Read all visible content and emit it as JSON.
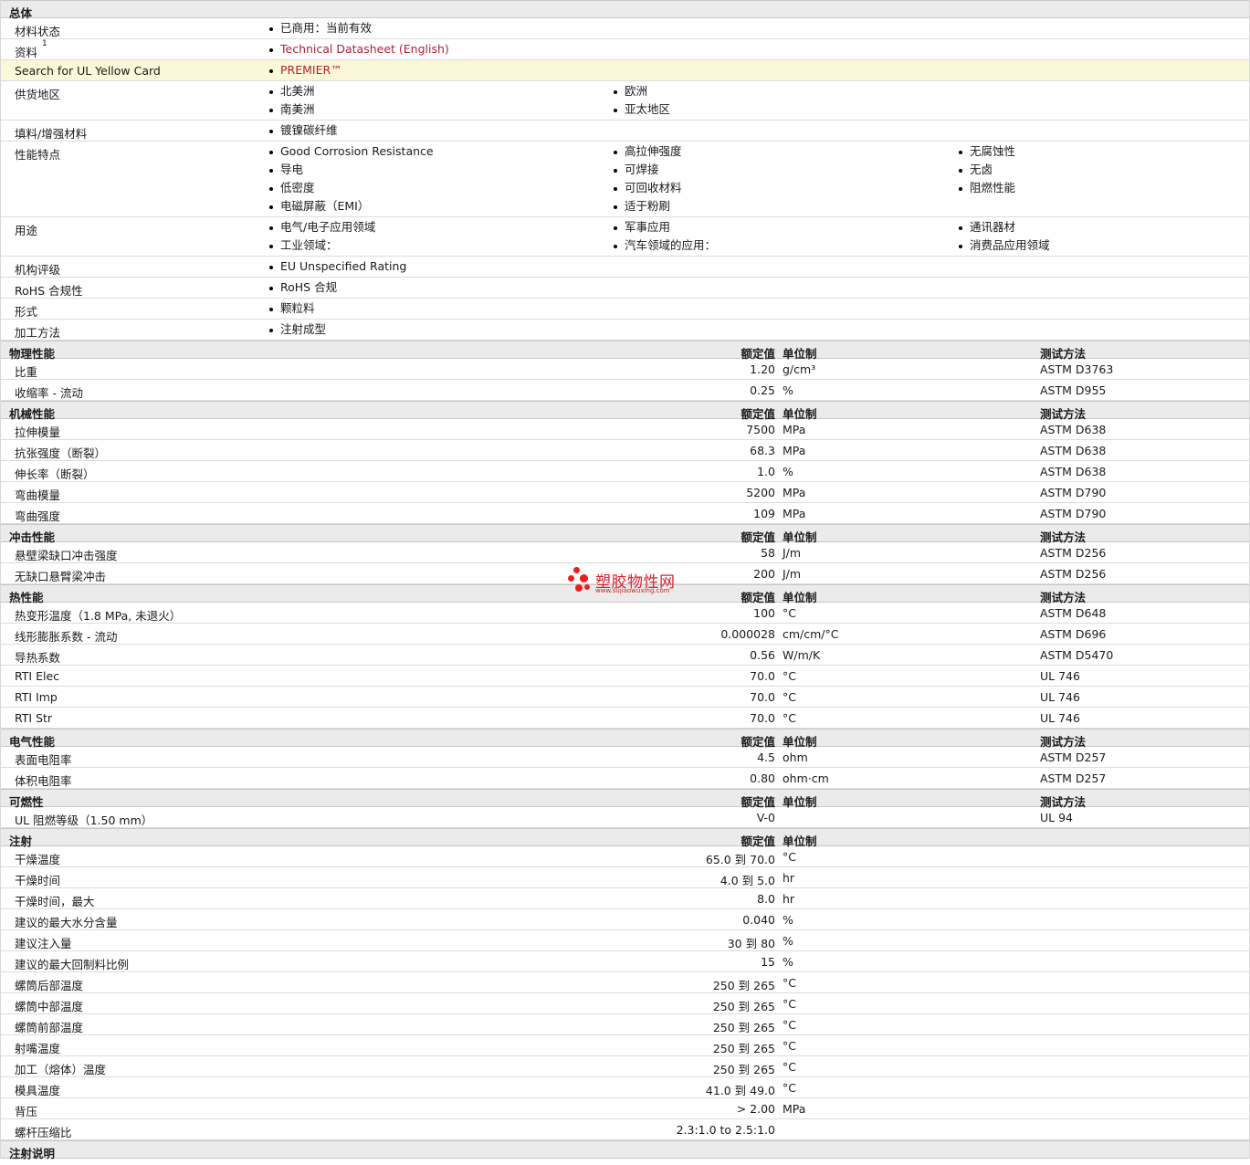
{
  "general": {
    "title": "总体",
    "rows": [
      {
        "label": "材料状态",
        "items": [
          [
            "已商用：当前有效"
          ]
        ]
      },
      {
        "label": "资料",
        "sup": "1",
        "link": true,
        "items": [
          [
            "Technical Datasheet (English)"
          ]
        ]
      },
      {
        "label": "Search for UL Yellow Card",
        "highlight": true,
        "link": true,
        "items": [
          [
            "PREMIER™"
          ]
        ]
      },
      {
        "label": "供货地区",
        "items": [
          [
            "北美洲",
            "南美洲"
          ],
          [
            "欧洲",
            "亚太地区"
          ]
        ]
      },
      {
        "label": "填料/增强材料",
        "items": [
          [
            "镀镍碳纤维"
          ]
        ]
      },
      {
        "label": "性能特点",
        "items": [
          [
            "Good Corrosion Resistance",
            "导电",
            "低密度",
            "电磁屏蔽（EMI）"
          ],
          [
            "高拉伸强度",
            "可焊接",
            "可回收材料",
            "适于粉刷"
          ],
          [
            "无腐蚀性",
            "无卤",
            "阻燃性能"
          ]
        ]
      },
      {
        "label": "用途",
        "items": [
          [
            "电气/电子应用领域",
            "工业领域："
          ],
          [
            "军事应用",
            "汽车领域的应用："
          ],
          [
            "通讯器材",
            "消费品应用领域"
          ]
        ]
      },
      {
        "label": "机构评级",
        "items": [
          [
            "EU Unspecified Rating"
          ]
        ]
      },
      {
        "label": "RoHS 合规性",
        "items": [
          [
            "RoHS 合规"
          ]
        ]
      },
      {
        "label": "形式",
        "items": [
          [
            "颗粒料"
          ]
        ]
      },
      {
        "label": "加工方法",
        "items": [
          [
            "注射成型"
          ]
        ]
      }
    ]
  },
  "col_headers": {
    "nominal": "额定值",
    "unit": "单位制",
    "test": "测试方法"
  },
  "sections": [
    {
      "title": "物理性能",
      "show_test": true,
      "rows": [
        {
          "label": "比重",
          "value": "1.20",
          "unit": "g/cm³",
          "test": "ASTM D3763"
        },
        {
          "label": "收缩率  - 流动",
          "value": "0.25",
          "unit": "%",
          "test": "ASTM D955"
        }
      ]
    },
    {
      "title": "机械性能",
      "show_test": true,
      "rows": [
        {
          "label": "拉伸模量",
          "value": "7500",
          "unit": "MPa",
          "test": "ASTM D638"
        },
        {
          "label": "抗张强度（断裂）",
          "value": "68.3",
          "unit": "MPa",
          "test": "ASTM D638"
        },
        {
          "label": "伸长率（断裂）",
          "value": "1.0",
          "unit": "%",
          "test": "ASTM D638"
        },
        {
          "label": "弯曲模量",
          "value": "5200",
          "unit": "MPa",
          "test": "ASTM D790"
        },
        {
          "label": "弯曲强度",
          "value": "109",
          "unit": "MPa",
          "test": "ASTM D790"
        }
      ]
    },
    {
      "title": "冲击性能",
      "show_test": true,
      "rows": [
        {
          "label": "悬壁梁缺口冲击强度",
          "value": "58",
          "unit": "J/m",
          "test": "ASTM D256"
        },
        {
          "label": "无缺口悬臂梁冲击",
          "value": "200",
          "unit": "J/m",
          "test": "ASTM D256"
        }
      ]
    },
    {
      "title": "热性能",
      "show_test": true,
      "rows": [
        {
          "label": "热变形温度（1.8 MPa, 未退火）",
          "value": "100",
          "unit": "°C",
          "test": "ASTM D648"
        },
        {
          "label": "线形膨胀系数  - 流动",
          "value": "0.000028",
          "unit": "cm/cm/°C",
          "test": "ASTM D696"
        },
        {
          "label": "导热系数",
          "value": "0.56",
          "unit": "W/m/K",
          "test": "ASTM D5470"
        },
        {
          "label": "RTI Elec",
          "value": "70.0",
          "unit": "°C",
          "test": "UL 746"
        },
        {
          "label": "RTI Imp",
          "value": "70.0",
          "unit": "°C",
          "test": "UL 746"
        },
        {
          "label": "RTI Str",
          "value": "70.0",
          "unit": "°C",
          "test": "UL 746"
        }
      ]
    },
    {
      "title": "电气性能",
      "show_test": true,
      "rows": [
        {
          "label": "表面电阻率",
          "value": "4.5",
          "unit": "ohm",
          "test": "ASTM D257"
        },
        {
          "label": "体积电阻率",
          "value": "0.80",
          "unit": "ohm·cm",
          "test": "ASTM D257"
        }
      ]
    },
    {
      "title": "可燃性",
      "show_test": true,
      "rows": [
        {
          "label": "UL 阻燃等级（1.50 mm）",
          "value": "V-0",
          "unit": "",
          "test": "UL 94"
        }
      ]
    },
    {
      "title": "注射",
      "show_test": false,
      "rows": [
        {
          "label": "干燥温度",
          "value": "65.0 到  70.0",
          "unit": "°C",
          "test": ""
        },
        {
          "label": "干燥时间",
          "value": "4.0 到  5.0",
          "unit": "hr",
          "test": ""
        },
        {
          "label": "干燥时间，最大",
          "value": "8.0",
          "unit": "hr",
          "test": ""
        },
        {
          "label": "建议的最大水分含量",
          "value": "0.040",
          "unit": "%",
          "test": ""
        },
        {
          "label": "建议注入量",
          "value": "30 到  80",
          "unit": "%",
          "test": ""
        },
        {
          "label": "建议的最大回制料比例",
          "value": "15",
          "unit": "%",
          "test": ""
        },
        {
          "label": "螺筒后部温度",
          "value": "250 到  265",
          "unit": "°C",
          "test": ""
        },
        {
          "label": "螺筒中部温度",
          "value": "250 到  265",
          "unit": "°C",
          "test": ""
        },
        {
          "label": "螺筒前部温度",
          "value": "250 到  265",
          "unit": "°C",
          "test": ""
        },
        {
          "label": "射嘴温度",
          "value": "250 到  265",
          "unit": "°C",
          "test": ""
        },
        {
          "label": "加工（熔体）温度",
          "value": "250 到  265",
          "unit": "°C",
          "test": ""
        },
        {
          "label": "模具温度",
          "value": "41.0 到  49.0",
          "unit": "°C",
          "test": ""
        },
        {
          "label": "背压",
          "value": "> 2.00",
          "unit": "MPa",
          "test": ""
        },
        {
          "label": "螺杆压缩比",
          "value": "2.3:1.0 to 2.5:1.0",
          "unit": "",
          "test": ""
        }
      ]
    },
    {
      "title": "注射说明",
      "show_test": false,
      "hide_cols": true,
      "rows": []
    }
  ],
  "watermark": {
    "name": "塑胶物性网",
    "url": "www.sujiaowuxing.com"
  },
  "colors": {
    "link": "#b0203a",
    "header_bg": "#ebebeb",
    "highlight": "#fbf8d8",
    "watermark": "#e0202a"
  }
}
